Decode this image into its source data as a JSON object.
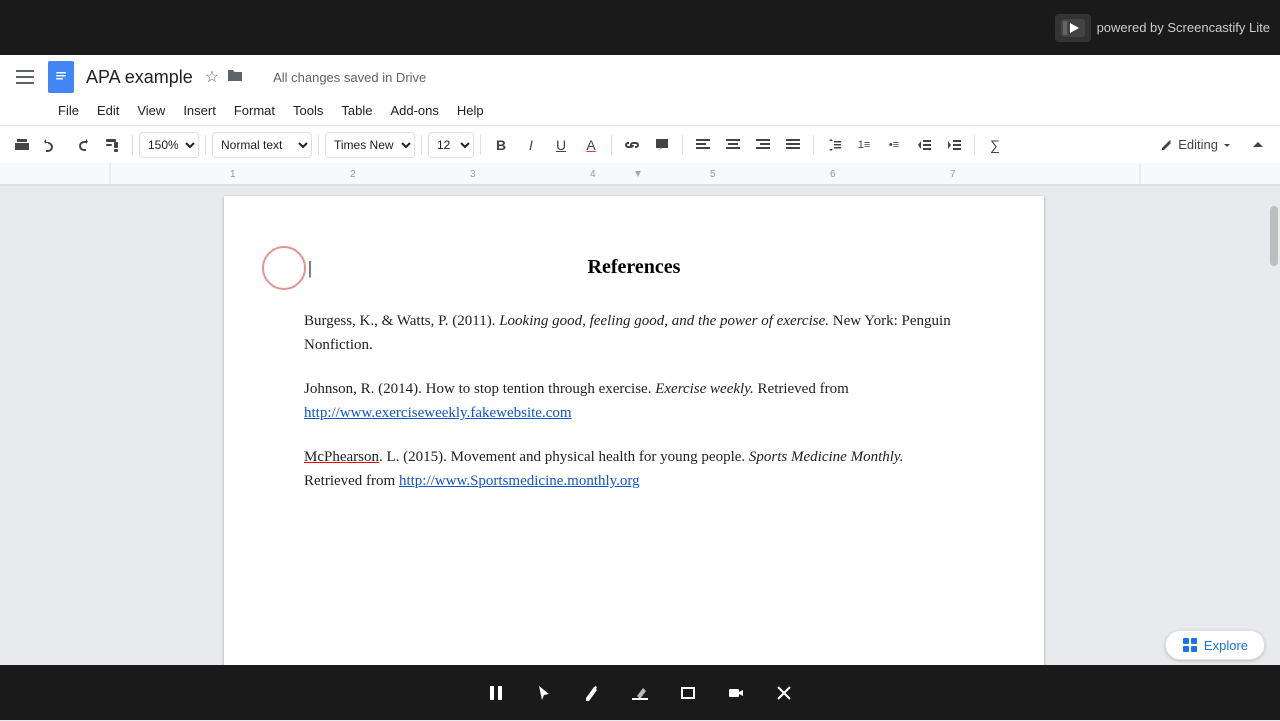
{
  "topBar": {
    "screencastify": "powered by Screencastify Lite"
  },
  "header": {
    "title": "APA example",
    "savedStatus": "All changes saved in Drive",
    "starLabel": "★",
    "folderLabel": "📁"
  },
  "menuBar": {
    "items": [
      "File",
      "Edit",
      "View",
      "Insert",
      "Format",
      "Tools",
      "Table",
      "Add-ons",
      "Help"
    ]
  },
  "toolbar": {
    "zoom": "150%",
    "style": "Normal text",
    "font": "Times New...",
    "fontSize": "12",
    "editingLabel": "Editing",
    "buttons": {
      "print": "🖨",
      "undo": "↩",
      "redo": "↪",
      "paintFormat": "🖌",
      "bold": "B",
      "italic": "I",
      "underline": "U",
      "textColor": "A",
      "link": "🔗",
      "comment": "💬",
      "alignLeft": "≡",
      "alignCenter": "≡",
      "alignRight": "≡",
      "justify": "≡",
      "lineSpacing": "↕",
      "numberedList": "1.",
      "bulletList": "•",
      "indentDecrease": "⇤",
      "indentIncrease": "⇥",
      "formula": "∑"
    }
  },
  "document": {
    "heading": "References",
    "entries": [
      {
        "id": "entry1",
        "normalText": "Burgess, K., & Watts, P. (2011). ",
        "italicText": "Looking good, feeling good, and the power of exercise.",
        "afterItalic": " New York: Penguin Nonfiction."
      },
      {
        "id": "entry2",
        "normalText": "Johnson, R. (2014). How to stop tention through exercise. ",
        "italicText": "Exercise weekly.",
        "afterItalic": " Retrieved from",
        "link": "http://www.exerciseweekly.fakewebsite.com"
      },
      {
        "id": "entry3",
        "normalText": "McPhearson",
        "afterName": ". L. (2015). Movement and physical health for young people. ",
        "italicText": "Sports Medicine Monthly.",
        "afterItalic": " Retrieved from ",
        "link": "http://www.Sportsmedicine.monthly.org"
      }
    ]
  },
  "bottomToolbar": {
    "buttons": [
      "⏸",
      "↖",
      "✏",
      "╱",
      "▭",
      "🎥",
      "✕"
    ]
  },
  "exploreBtn": {
    "label": "Explore",
    "icon": "+"
  }
}
